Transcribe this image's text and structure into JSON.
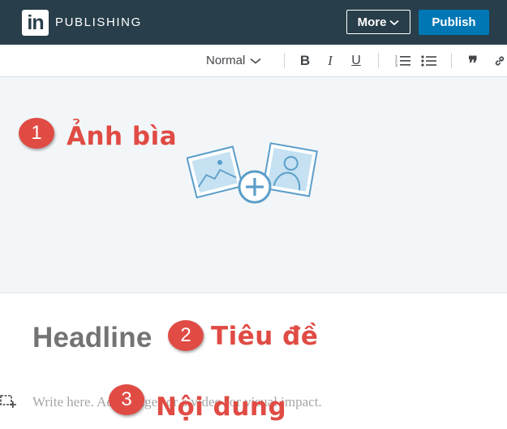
{
  "header": {
    "logo_text": "in",
    "brand": "PUBLISHING",
    "more_label": "More",
    "publish_label": "Publish"
  },
  "toolbar": {
    "style_value": "Normal",
    "bold": "B",
    "italic": "I",
    "underline": "U",
    "quote": "❞",
    "icons": [
      "chevron-down-icon",
      "numbered-list-icon",
      "bulleted-list-icon",
      "link-icon"
    ]
  },
  "annotations": [
    {
      "number": "1",
      "label": "Ảnh bìa"
    },
    {
      "number": "2",
      "label": "Tiêu đề"
    },
    {
      "number": "3",
      "label": "Nội dung"
    }
  ],
  "editor": {
    "headline_placeholder": "Headline",
    "body_placeholder": "Write here. Add images or a video for visual impact."
  },
  "colors": {
    "header_bg": "#283e4a",
    "publish_blue": "#0077b5",
    "cover_bg": "#f3f6f8",
    "annotation_red": "#e04b44",
    "illustration_blue": "#5b9ec9"
  }
}
